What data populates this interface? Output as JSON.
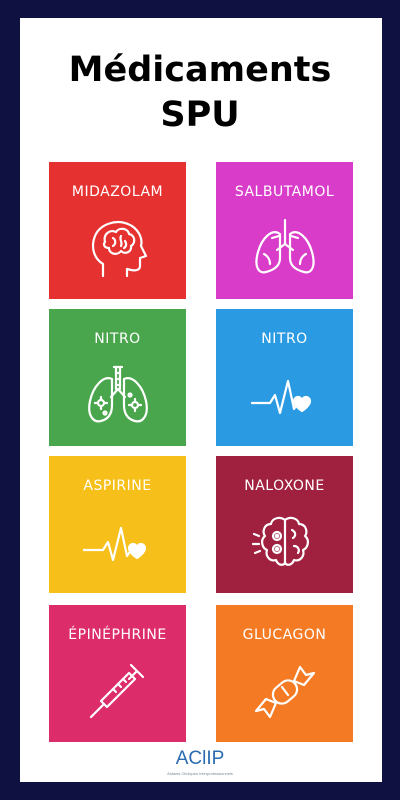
{
  "title": {
    "line1": "Médicaments",
    "line2": "SPU"
  },
  "tiles": [
    {
      "label": "MIDAZOLAM",
      "color": "#e63131",
      "icon": "brain-head-icon"
    },
    {
      "label": "SALBUTAMOL",
      "color": "#d93cc9",
      "icon": "lungs-icon"
    },
    {
      "label": "NITRO",
      "color": "#4aa64c",
      "icon": "infected-lungs-icon"
    },
    {
      "label": "NITRO",
      "color": "#2a9ae3",
      "icon": "heartbeat-icon"
    },
    {
      "label": "ASPIRINE",
      "color": "#f6bf1a",
      "icon": "heartbeat-icon"
    },
    {
      "label": "NALOXONE",
      "color": "#a0203f",
      "icon": "brain-gears-icon"
    },
    {
      "label": "ÉPINÉPHRINE",
      "color": "#dc2d6a",
      "icon": "syringe-icon"
    },
    {
      "label": "GLUCAGON",
      "color": "#f47a24",
      "icon": "candy-icon"
    }
  ],
  "logo": {
    "brand": "AClIP",
    "tagline": "Aidants Cliniques Interprofessionnels"
  }
}
